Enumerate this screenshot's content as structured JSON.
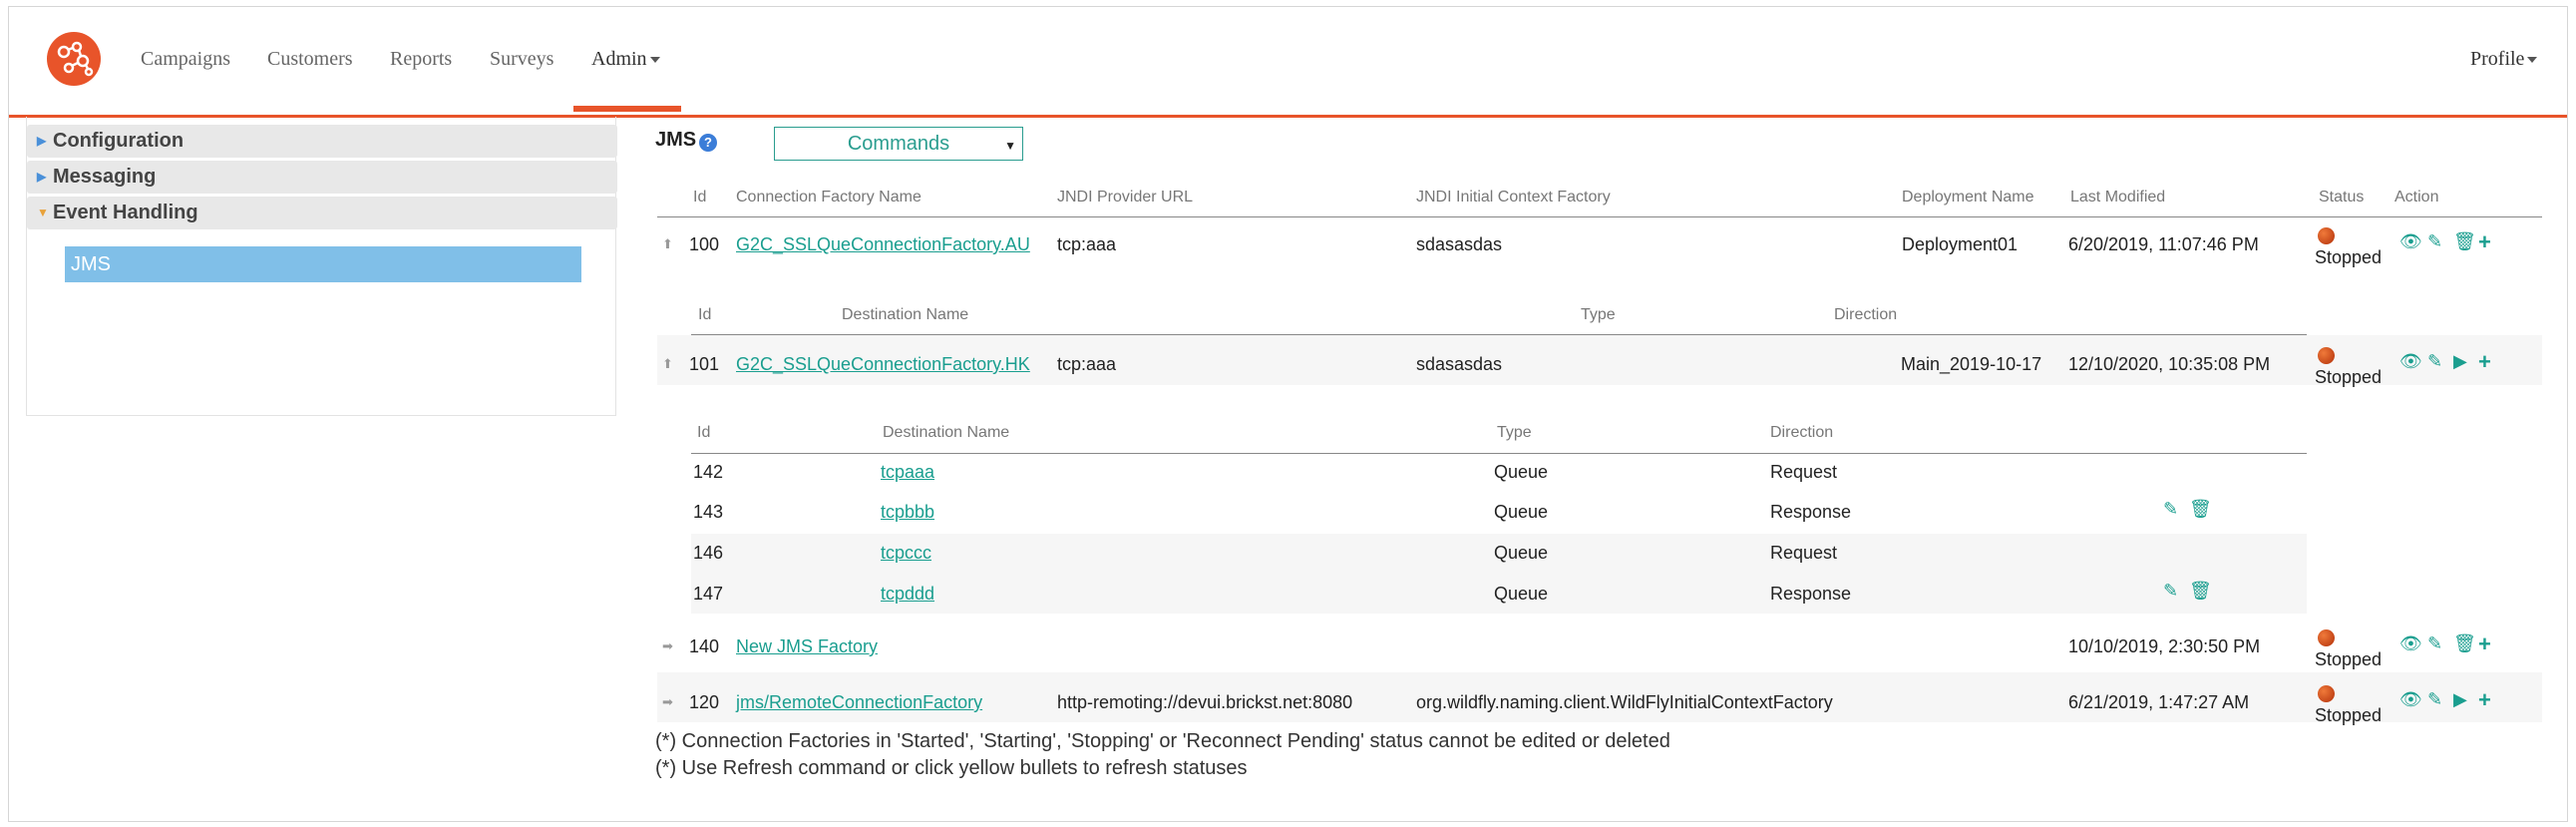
{
  "nav": {
    "items": [
      "Campaigns",
      "Customers",
      "Reports",
      "Surveys",
      "Admin"
    ],
    "profile": "Profile"
  },
  "sidebar": {
    "sections": [
      "Configuration",
      "Messaging",
      "Event Handling"
    ],
    "active_item": "JMS"
  },
  "main": {
    "title": "JMS",
    "help_icon": "question-circle-icon",
    "commands_label": "Commands",
    "columns": [
      "Id",
      "Connection Factory Name",
      "JNDI Provider URL",
      "JNDI Initial Context Factory",
      "Deployment Name",
      "Last Modified",
      "Status",
      "Action"
    ],
    "dest_columns": [
      "Id",
      "Destination Name",
      "Type",
      "Direction"
    ],
    "factories": [
      {
        "id": "100",
        "name": "G2C_SSLQueConnectionFactory.AU",
        "url": "tcp:aaa",
        "ctx": "sdasasdas",
        "deploy": "Deployment01",
        "modified": "6/20/2019, 11:07:46 PM",
        "status": "Stopped"
      },
      {
        "id": "101",
        "name": "G2C_SSLQueConnectionFactory.HK",
        "url": "tcp:aaa",
        "ctx": "sdasasdas",
        "deploy": "Main_2019-10-17",
        "modified": "12/10/2020, 10:35:08 PM",
        "status": "Stopped"
      },
      {
        "id": "140",
        "name": "New JMS Factory",
        "url": "",
        "ctx": "",
        "deploy": "",
        "modified": "10/10/2019, 2:30:50 PM",
        "status": "Stopped"
      },
      {
        "id": "120",
        "name": "jms/RemoteConnectionFactory",
        "url": "http-remoting://devui.brickst.net:8080",
        "ctx": "org.wildfly.naming.client.WildFlyInitialContextFactory",
        "deploy": "",
        "modified": "6/21/2019, 1:47:27 AM",
        "status": "Stopped"
      }
    ],
    "destinations": [
      {
        "id": "142",
        "name": "tcpaaa",
        "type": "Queue",
        "direction": "Request"
      },
      {
        "id": "143",
        "name": "tcpbbb",
        "type": "Queue",
        "direction": "Response"
      },
      {
        "id": "146",
        "name": "tcpccc",
        "type": "Queue",
        "direction": "Request"
      },
      {
        "id": "147",
        "name": "tcpddd",
        "type": "Queue",
        "direction": "Response"
      }
    ],
    "notes": [
      "(*) Connection Factories in 'Started', 'Starting', 'Stopping' or 'Reconnect Pending' status cannot be edited or deleted",
      "(*) Use Refresh command or click yellow bullets to refresh statuses"
    ]
  },
  "colors": {
    "accent": "#e8542a",
    "link": "#1a9e8f",
    "sidebar_active": "#80bfe8"
  }
}
